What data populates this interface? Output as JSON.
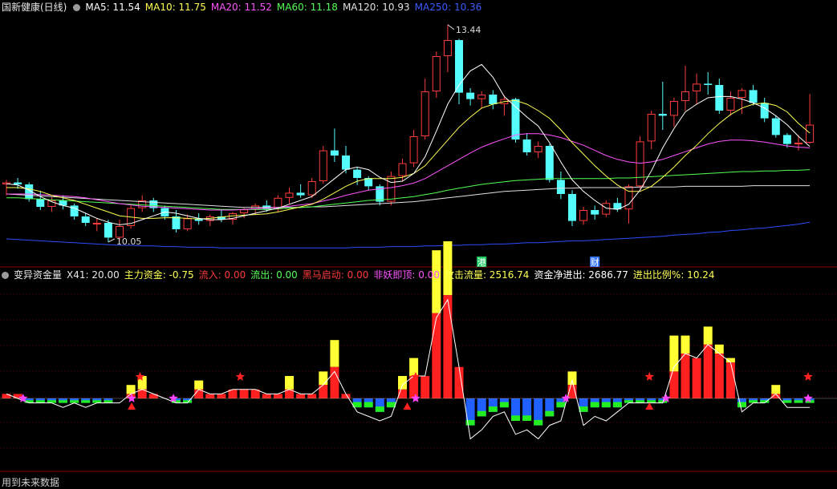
{
  "colors": {
    "up": "#ff3b3b",
    "down": "#54fcfc",
    "ma5": "#ffffff",
    "ma10": "#ffff54",
    "ma20": "#ff54ff",
    "ma60": "#54ff54",
    "ma120": "#e0e0e0",
    "ma250": "#2a4cff",
    "flow_red": "#ff2020",
    "flow_yellow": "#ffff33",
    "flow_blue": "#2060ff",
    "flow_green": "#22ee22"
  },
  "header": {
    "title": "国新健康(日线)",
    "ma5": "MA5: 11.54",
    "ma10": "MA10: 11.75",
    "ma20": "MA20: 11.52",
    "ma60": "MA60: 11.18",
    "ma120": "MA120: 10.93",
    "ma250": "MA250: 10.36"
  },
  "indicator": {
    "title": "变异资金量",
    "x41": "X41: 20.00",
    "main_fund": "主力资金: -0.75",
    "inflow": "流入: 0.00",
    "outflow": "流出: 0.00",
    "dark_horse": "黑马启动: 0.00",
    "monster_top": "非妖即顶: 0.00",
    "attack_flow": "攻击流量: 2516.74",
    "net_flow": "资金净进出: 2686.77",
    "ratio": "进出比例%: 10.24"
  },
  "footer": "用到未来数据",
  "chart_data": {
    "type": "candlestick",
    "high_label": "13.44",
    "low_label": "10.05",
    "events": [
      {
        "label": "港",
        "index": 42,
        "color": "#22cc66"
      },
      {
        "label": "财",
        "index": 52,
        "color": "#3a78ff"
      }
    ],
    "ohlc": [
      [
        10.95,
        11.02,
        10.78,
        10.98
      ],
      [
        10.98,
        11.05,
        10.88,
        10.95
      ],
      [
        10.95,
        10.98,
        10.68,
        10.72
      ],
      [
        10.72,
        10.85,
        10.55,
        10.6
      ],
      [
        10.6,
        10.75,
        10.52,
        10.7
      ],
      [
        10.7,
        10.78,
        10.56,
        10.62
      ],
      [
        10.62,
        10.65,
        10.4,
        10.45
      ],
      [
        10.45,
        10.5,
        10.3,
        10.35
      ],
      [
        10.35,
        10.42,
        10.22,
        10.35
      ],
      [
        10.35,
        10.4,
        10.05,
        10.12
      ],
      [
        10.12,
        10.4,
        10.08,
        10.3
      ],
      [
        10.3,
        10.62,
        10.26,
        10.58
      ],
      [
        10.58,
        10.78,
        10.52,
        10.7
      ],
      [
        10.7,
        10.74,
        10.52,
        10.58
      ],
      [
        10.58,
        10.62,
        10.4,
        10.45
      ],
      [
        10.45,
        10.55,
        10.2,
        10.25
      ],
      [
        10.25,
        10.48,
        10.22,
        10.42
      ],
      [
        10.42,
        10.5,
        10.32,
        10.38
      ],
      [
        10.38,
        10.48,
        10.3,
        10.45
      ],
      [
        10.45,
        10.55,
        10.36,
        10.4
      ],
      [
        10.4,
        10.52,
        10.32,
        10.5
      ],
      [
        10.5,
        10.58,
        10.42,
        10.56
      ],
      [
        10.56,
        10.65,
        10.48,
        10.62
      ],
      [
        10.62,
        10.7,
        10.52,
        10.56
      ],
      [
        10.56,
        10.78,
        10.52,
        10.74
      ],
      [
        10.74,
        10.9,
        10.65,
        10.82
      ],
      [
        10.82,
        10.95,
        10.74,
        10.78
      ],
      [
        10.78,
        11.05,
        10.74,
        11.0
      ],
      [
        11.0,
        11.55,
        10.96,
        11.48
      ],
      [
        11.48,
        11.82,
        11.3,
        11.4
      ],
      [
        11.4,
        11.55,
        11.12,
        11.18
      ],
      [
        11.18,
        11.22,
        10.94,
        11.05
      ],
      [
        11.05,
        11.08,
        10.86,
        10.92
      ],
      [
        10.92,
        10.95,
        10.62,
        10.68
      ],
      [
        10.68,
        11.15,
        10.62,
        11.08
      ],
      [
        11.08,
        11.35,
        11.0,
        11.28
      ],
      [
        11.28,
        11.8,
        11.22,
        11.7
      ],
      [
        11.7,
        12.6,
        11.65,
        12.4
      ],
      [
        12.4,
        13.02,
        12.3,
        12.95
      ],
      [
        12.95,
        13.44,
        12.7,
        13.2
      ],
      [
        13.2,
        13.22,
        12.2,
        12.38
      ],
      [
        12.38,
        12.45,
        12.18,
        12.28
      ],
      [
        12.28,
        12.4,
        12.14,
        12.35
      ],
      [
        12.35,
        12.42,
        12.12,
        12.2
      ],
      [
        12.2,
        12.34,
        12.02,
        12.28
      ],
      [
        12.28,
        12.3,
        11.6,
        11.65
      ],
      [
        11.65,
        11.75,
        11.4,
        11.45
      ],
      [
        11.45,
        11.62,
        11.36,
        11.55
      ],
      [
        11.55,
        11.58,
        10.98,
        11.02
      ],
      [
        11.02,
        11.15,
        10.72,
        10.8
      ],
      [
        10.8,
        10.86,
        10.3,
        10.38
      ],
      [
        10.38,
        10.6,
        10.32,
        10.55
      ],
      [
        10.55,
        10.62,
        10.4,
        10.48
      ],
      [
        10.48,
        10.7,
        10.44,
        10.66
      ],
      [
        10.66,
        10.74,
        10.52,
        10.56
      ],
      [
        10.56,
        10.95,
        10.34,
        10.92
      ],
      [
        10.92,
        11.7,
        10.86,
        11.62
      ],
      [
        11.62,
        12.1,
        11.5,
        12.05
      ],
      [
        12.05,
        12.55,
        11.8,
        12.02
      ],
      [
        12.02,
        12.3,
        11.85,
        12.25
      ],
      [
        12.25,
        12.8,
        12.1,
        12.4
      ],
      [
        12.4,
        12.68,
        12.2,
        12.52
      ],
      [
        12.52,
        12.7,
        12.35,
        12.5
      ],
      [
        12.5,
        12.6,
        12.05,
        12.1
      ],
      [
        12.1,
        12.4,
        12.02,
        12.3
      ],
      [
        12.3,
        12.45,
        12.05,
        12.42
      ],
      [
        12.42,
        12.5,
        12.18,
        12.22
      ],
      [
        12.22,
        12.3,
        11.92,
        11.98
      ],
      [
        11.98,
        12.02,
        11.68,
        11.72
      ],
      [
        11.72,
        11.75,
        11.52,
        11.58
      ],
      [
        11.58,
        11.72,
        11.48,
        11.6
      ],
      [
        11.6,
        12.36,
        11.58,
        11.88
      ]
    ],
    "ma5": [
      10.96,
      10.94,
      10.86,
      10.76,
      10.68,
      10.62,
      10.58,
      10.5,
      10.42,
      10.36,
      10.32,
      10.34,
      10.4,
      10.46,
      10.52,
      10.5,
      10.46,
      10.42,
      10.4,
      10.4,
      10.42,
      10.46,
      10.5,
      10.54,
      10.58,
      10.64,
      10.7,
      10.76,
      10.9,
      11.04,
      11.18,
      11.22,
      11.18,
      11.06,
      10.98,
      11.0,
      11.12,
      11.38,
      11.78,
      12.2,
      12.5,
      12.72,
      12.82,
      12.62,
      12.32,
      12.16,
      12.0,
      11.86,
      11.6,
      11.3,
      11.02,
      10.84,
      10.7,
      10.58,
      10.56,
      10.64,
      10.86,
      11.16,
      11.52,
      11.82,
      12.08,
      12.2,
      12.3,
      12.32,
      12.32,
      12.28,
      12.22,
      12.14,
      12.02,
      11.88,
      11.7,
      11.54
    ],
    "ma10": [
      10.9,
      10.9,
      10.88,
      10.84,
      10.78,
      10.74,
      10.7,
      10.64,
      10.58,
      10.52,
      10.46,
      10.44,
      10.42,
      10.42,
      10.43,
      10.43,
      10.42,
      10.41,
      10.42,
      10.44,
      10.46,
      10.47,
      10.48,
      10.49,
      10.52,
      10.56,
      10.6,
      10.64,
      10.72,
      10.82,
      10.92,
      11.0,
      11.04,
      11.04,
      11.04,
      11.06,
      11.12,
      11.24,
      11.44,
      11.64,
      11.84,
      12.0,
      12.14,
      12.2,
      12.24,
      12.26,
      12.2,
      12.1,
      11.98,
      11.8,
      11.6,
      11.42,
      11.24,
      11.08,
      10.94,
      10.84,
      10.84,
      10.92,
      11.06,
      11.22,
      11.4,
      11.56,
      11.74,
      11.9,
      12.04,
      12.14,
      12.2,
      12.22,
      12.18,
      12.08,
      11.9,
      11.75
    ],
    "ma20": [
      10.8,
      10.8,
      10.8,
      10.79,
      10.78,
      10.77,
      10.76,
      10.74,
      10.71,
      10.68,
      10.65,
      10.63,
      10.61,
      10.6,
      10.59,
      10.58,
      10.57,
      10.56,
      10.55,
      10.55,
      10.55,
      10.56,
      10.57,
      10.58,
      10.59,
      10.61,
      10.63,
      10.65,
      10.69,
      10.73,
      10.78,
      10.82,
      10.86,
      10.88,
      10.9,
      10.93,
      10.97,
      11.04,
      11.14,
      11.24,
      11.34,
      11.44,
      11.53,
      11.6,
      11.66,
      11.72,
      11.74,
      11.74,
      11.72,
      11.68,
      11.62,
      11.56,
      11.48,
      11.4,
      11.34,
      11.3,
      11.28,
      11.3,
      11.34,
      11.4,
      11.46,
      11.52,
      11.58,
      11.62,
      11.64,
      11.64,
      11.63,
      11.61,
      11.58,
      11.55,
      11.53,
      11.52
    ],
    "ma60": [
      10.74,
      10.74,
      10.73,
      10.72,
      10.71,
      10.7,
      10.69,
      10.68,
      10.67,
      10.66,
      10.65,
      10.64,
      10.63,
      10.62,
      10.61,
      10.6,
      10.59,
      10.58,
      10.57,
      10.56,
      10.56,
      10.56,
      10.56,
      10.56,
      10.57,
      10.58,
      10.59,
      10.6,
      10.62,
      10.64,
      10.66,
      10.68,
      10.7,
      10.71,
      10.72,
      10.74,
      10.76,
      10.79,
      10.82,
      10.86,
      10.89,
      10.92,
      10.95,
      10.97,
      10.99,
      11.01,
      11.02,
      11.03,
      11.04,
      11.04,
      11.04,
      11.04,
      11.04,
      11.04,
      11.05,
      11.05,
      11.06,
      11.07,
      11.08,
      11.09,
      11.1,
      11.11,
      11.12,
      11.13,
      11.14,
      11.15,
      11.15,
      11.16,
      11.16,
      11.17,
      11.17,
      11.18
    ],
    "ma120": [
      10.8,
      10.79,
      10.78,
      10.77,
      10.76,
      10.75,
      10.74,
      10.73,
      10.72,
      10.71,
      10.7,
      10.69,
      10.68,
      10.67,
      10.66,
      10.65,
      10.64,
      10.63,
      10.62,
      10.61,
      10.6,
      10.59,
      10.59,
      10.59,
      10.59,
      10.59,
      10.59,
      10.6,
      10.6,
      10.61,
      10.62,
      10.63,
      10.64,
      10.65,
      10.66,
      10.67,
      10.68,
      10.7,
      10.72,
      10.74,
      10.76,
      10.78,
      10.8,
      10.82,
      10.84,
      10.85,
      10.86,
      10.87,
      10.88,
      10.89,
      10.89,
      10.9,
      10.9,
      10.9,
      10.9,
      10.9,
      10.91,
      10.91,
      10.91,
      10.91,
      10.92,
      10.92,
      10.92,
      10.92,
      10.92,
      10.92,
      10.93,
      10.93,
      10.93,
      10.93,
      10.93,
      10.93
    ],
    "ma250": [
      10.1,
      10.09,
      10.08,
      10.07,
      10.06,
      10.05,
      10.04,
      10.03,
      10.02,
      10.01,
      10.0,
      10.0,
      9.99,
      9.99,
      9.98,
      9.98,
      9.97,
      9.97,
      9.97,
      9.96,
      9.96,
      9.96,
      9.96,
      9.96,
      9.96,
      9.96,
      9.96,
      9.96,
      9.96,
      9.96,
      9.96,
      9.97,
      9.97,
      9.97,
      9.98,
      9.98,
      9.98,
      9.99,
      9.99,
      10.0,
      10.0,
      10.01,
      10.01,
      10.02,
      10.02,
      10.03,
      10.04,
      10.04,
      10.05,
      10.06,
      10.07,
      10.07,
      10.08,
      10.09,
      10.1,
      10.11,
      10.12,
      10.13,
      10.14,
      10.16,
      10.17,
      10.18,
      10.2,
      10.21,
      10.23,
      10.24,
      10.26,
      10.27,
      10.29,
      10.31,
      10.33,
      10.36
    ],
    "flow": [
      [
        1,
        0,
        1
      ],
      [
        1,
        0,
        0
      ],
      [
        -1,
        0,
        -1
      ],
      [
        -1,
        0,
        -1
      ],
      [
        -1,
        0,
        -1
      ],
      [
        -1,
        0,
        -2
      ],
      [
        -1,
        0,
        -1
      ],
      [
        -1,
        0,
        -2
      ],
      [
        -1,
        0,
        -1
      ],
      [
        -1,
        0,
        -1
      ],
      [
        0,
        0,
        -1
      ],
      [
        1,
        2,
        1
      ],
      [
        2,
        3,
        2
      ],
      [
        1,
        0,
        1
      ],
      [
        0,
        0,
        0
      ],
      [
        -1,
        0,
        -1
      ],
      [
        -1,
        0,
        -1
      ],
      [
        2,
        2,
        2
      ],
      [
        1,
        0,
        1
      ],
      [
        1,
        0,
        1
      ],
      [
        2,
        0,
        2
      ],
      [
        2,
        0,
        2
      ],
      [
        2,
        0,
        2
      ],
      [
        1,
        0,
        1
      ],
      [
        1,
        0,
        1
      ],
      [
        2,
        3,
        2
      ],
      [
        1,
        0,
        1
      ],
      [
        1,
        0,
        1
      ],
      [
        3,
        3,
        3
      ],
      [
        7,
        6,
        6
      ],
      [
        1,
        0,
        1
      ],
      [
        -2,
        0,
        -3
      ],
      [
        -2,
        0,
        -4
      ],
      [
        -3,
        0,
        -5
      ],
      [
        -2,
        0,
        -4
      ],
      [
        2,
        3,
        3
      ],
      [
        5,
        4,
        5
      ],
      [
        5,
        0,
        5
      ],
      [
        19,
        14,
        18
      ],
      [
        23,
        12,
        22
      ],
      [
        7,
        0,
        7
      ],
      [
        -6,
        0,
        -9
      ],
      [
        -4,
        0,
        -7
      ],
      [
        -3,
        0,
        -4
      ],
      [
        -2,
        0,
        -3
      ],
      [
        -5,
        0,
        -8
      ],
      [
        -5,
        0,
        -7
      ],
      [
        -6,
        0,
        -9
      ],
      [
        -4,
        0,
        -6
      ],
      [
        -2,
        0,
        -5
      ],
      [
        3,
        3,
        4
      ],
      [
        -3,
        0,
        -6
      ],
      [
        -2,
        0,
        -4
      ],
      [
        -2,
        0,
        -5
      ],
      [
        -2,
        0,
        -3
      ],
      [
        -1,
        0,
        -1
      ],
      [
        -1,
        0,
        -1
      ],
      [
        -1,
        0,
        -1
      ],
      [
        -1,
        0,
        -1
      ],
      [
        6,
        8,
        7
      ],
      [
        10,
        4,
        10
      ],
      [
        9,
        0,
        9
      ],
      [
        12,
        4,
        12
      ],
      [
        10,
        2,
        10
      ],
      [
        8,
        1,
        8
      ],
      [
        -2,
        0,
        -3
      ],
      [
        -1,
        0,
        -1
      ],
      [
        -1,
        0,
        -1
      ],
      [
        1,
        2,
        1
      ],
      [
        -1,
        0,
        -2
      ],
      [
        -1,
        0,
        -2
      ],
      [
        -1,
        0,
        -2
      ]
    ],
    "purple_star_idx": [
      2,
      15,
      20,
      49,
      67,
      79,
      96
    ],
    "red_star_idx": [
      16,
      28,
      49,
      77,
      96
    ],
    "red_triangle_idx": [
      15,
      48,
      77
    ],
    "_note_ignore": ""
  }
}
